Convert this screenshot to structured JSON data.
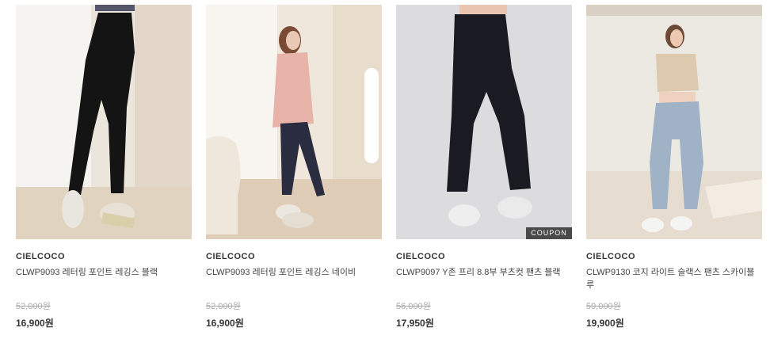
{
  "products": [
    {
      "brand": "CIELCOCO",
      "name": "CLWP9093 레터링 포인트 레깅스 블랙",
      "original_price": "52,000원",
      "sale_price": "16,900원",
      "badge": ""
    },
    {
      "brand": "CIELCOCO",
      "name": "CLWP9093 레터링 포인트 레깅스 네이비",
      "original_price": "52,000원",
      "sale_price": "16,900원",
      "badge": ""
    },
    {
      "brand": "CIELCOCO",
      "name": "CLWP9097 Y존 프리 8.8부 부츠컷 팬츠 블랙",
      "original_price": "56,000원",
      "sale_price": "17,950원",
      "badge": "COUPON"
    },
    {
      "brand": "CIELCOCO",
      "name": "CLWP9130 코지 라이트 슬랙스 팬츠 스카이블루",
      "original_price": "59,000원",
      "sale_price": "19,900원",
      "badge": ""
    }
  ]
}
